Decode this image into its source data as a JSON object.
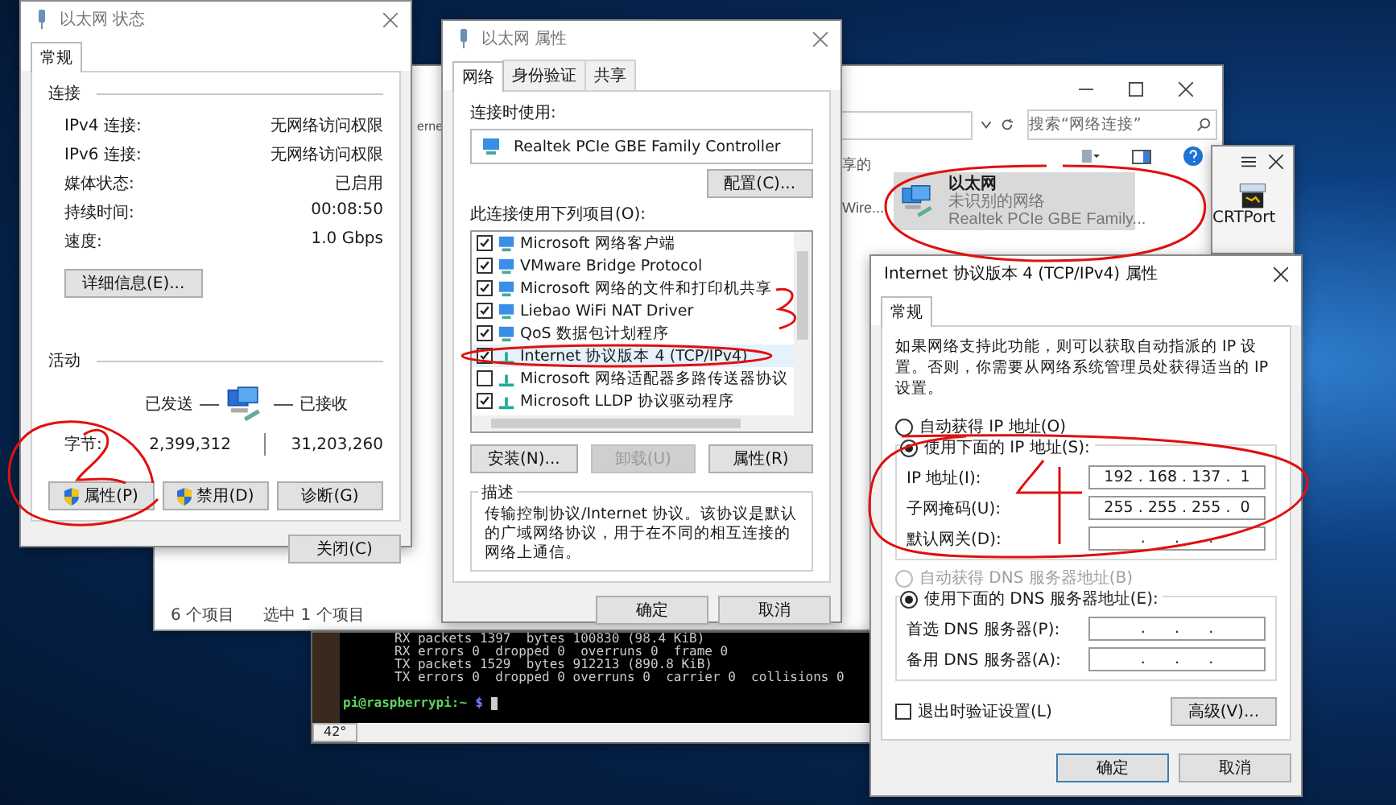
{
  "explorer": {
    "search": {
      "placeholder": "搜索“网络连接”"
    },
    "partial_texts": [
      "erne",
      "享的",
      "Wire..."
    ],
    "item": {
      "name": "以太网",
      "status": "未识别的网络",
      "device": "Realtek PCIe GBE Family...",
      "selected": true
    },
    "status_bar": [
      "6 个项目",
      "选中 1 个项目"
    ]
  },
  "side_window": {
    "label": "CRTPort"
  },
  "terminal": {
    "lines": [
      "RX packets 1397  bytes 100830 (98.4 KiB)",
      "RX errors 0  dropped 0  overruns 0  frame 0",
      "TX packets 1529  bytes 912213 (890.8 KiB)",
      "TX errors 0  dropped 0 overruns 0  carrier 0  collisions 0"
    ],
    "prompt": "pi@raspberrypi:~",
    "prompt_symbol": "$",
    "tab": "42°"
  },
  "status_dialog": {
    "title": "以太网 状态",
    "tabs": [
      {
        "label": "常规",
        "selected": true
      }
    ],
    "connection": {
      "heading": "连接",
      "rows": [
        {
          "label": "IPv4 连接:",
          "value": "无网络访问权限"
        },
        {
          "label": "IPv6 连接:",
          "value": "无网络访问权限"
        },
        {
          "label": "媒体状态:",
          "value": "已启用"
        },
        {
          "label": "持续时间:",
          "value": "00:08:50"
        },
        {
          "label": "速度:",
          "value": "1.0 Gbps"
        }
      ]
    },
    "details_button": "详细信息(E)...",
    "activity": {
      "heading": "活动",
      "sent": "已发送",
      "received": "已接收",
      "bytes_label": "字节:",
      "bytes_sent": "2,399,312",
      "bytes_received": "31,203,260"
    },
    "buttons": [
      {
        "label": "属性(P)",
        "shield": true
      },
      {
        "label": "禁用(D)",
        "shield": true
      },
      {
        "label": "诊断(G)",
        "shield": false
      }
    ],
    "close_button": "关闭(C)"
  },
  "properties_dialog": {
    "title": "以太网 属性",
    "tabs": [
      {
        "label": "网络",
        "selected": true
      },
      {
        "label": "身份验证",
        "selected": false
      },
      {
        "label": "共享",
        "selected": false
      }
    ],
    "connect_using_label": "连接时使用:",
    "adapter": "Realtek PCIe GBE Family Controller",
    "configure_button": "配置(C)...",
    "items_label": "此连接使用下列项目(O):",
    "items": [
      {
        "label": "Microsoft 网络客户端",
        "kind": "service",
        "checked": true,
        "selected": false
      },
      {
        "label": "VMware Bridge Protocol",
        "kind": "service",
        "checked": true,
        "selected": false
      },
      {
        "label": "Microsoft 网络的文件和打印机共享",
        "kind": "service",
        "checked": true,
        "selected": false
      },
      {
        "label": "Liebao WiFi NAT Driver",
        "kind": "service",
        "checked": true,
        "selected": false
      },
      {
        "label": "QoS 数据包计划程序",
        "kind": "service",
        "checked": true,
        "selected": false
      },
      {
        "label": "Internet 协议版本 4 (TCP/IPv4)",
        "kind": "protocol",
        "checked": true,
        "selected": true
      },
      {
        "label": "Microsoft 网络适配器多路传送器协议",
        "kind": "protocol",
        "checked": false,
        "selected": false
      },
      {
        "label": "Microsoft LLDP 协议驱动程序",
        "kind": "protocol",
        "checked": true,
        "selected": false
      }
    ],
    "buttons": [
      {
        "label": "安装(N)...",
        "disabled": false
      },
      {
        "label": "卸载(U)",
        "disabled": true
      },
      {
        "label": "属性(R)",
        "disabled": false
      }
    ],
    "description": {
      "heading": "描述",
      "text": "传输控制协议/Internet 协议。该协议是默认的广域网络协议，用于在不同的相互连接的网络上通信。"
    },
    "ok": "确定",
    "cancel": "取消"
  },
  "ipv4_dialog": {
    "title": "Internet 协议版本 4 (TCP/IPv4) 属性",
    "tabs": [
      {
        "label": "常规",
        "selected": true
      }
    ],
    "intro": "如果网络支持此功能，则可以获取自动指派的 IP 设置。否则，你需要从网络系统管理员处获得适当的 IP 设置。",
    "ip_modes": [
      {
        "label": "自动获得 IP 地址(O)",
        "selected": false,
        "disabled": false
      },
      {
        "label": "使用下面的 IP 地址(S):",
        "selected": true,
        "disabled": false
      }
    ],
    "ip_fields": [
      {
        "label": "IP 地址(I):",
        "value": "192 . 168 . 137 .  1"
      },
      {
        "label": "子网掩码(U):",
        "value": "255 . 255 . 255 .  0"
      },
      {
        "label": "默认网关(D):",
        "value": ".      .      ."
      }
    ],
    "dns_modes": [
      {
        "label": "自动获得 DNS 服务器地址(B)",
        "selected": false,
        "disabled": true
      },
      {
        "label": "使用下面的 DNS 服务器地址(E):",
        "selected": true,
        "disabled": false
      }
    ],
    "dns_fields": [
      {
        "label": "首选 DNS 服务器(P):",
        "value": ".      .      ."
      },
      {
        "label": "备用 DNS 服务器(A):",
        "value": ".      .      ."
      }
    ],
    "validate": {
      "label": "退出时验证设置(L)",
      "checked": false
    },
    "advanced_button": "高级(V)...",
    "ok": "确定",
    "cancel": "取消"
  }
}
